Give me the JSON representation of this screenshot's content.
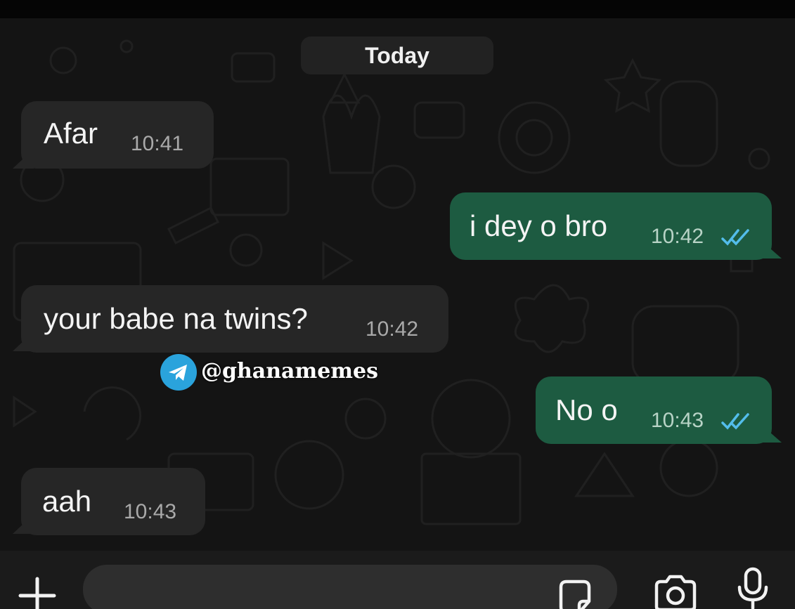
{
  "date_divider": "Today",
  "messages": [
    {
      "direction": "incoming",
      "text": "Afar",
      "time": "10:41"
    },
    {
      "direction": "outgoing",
      "text": "i dey o bro",
      "time": "10:42",
      "status": "read"
    },
    {
      "direction": "incoming",
      "text": "your babe na twins?",
      "time": "10:42"
    },
    {
      "direction": "outgoing",
      "text": "No o",
      "time": "10:43",
      "status": "read"
    },
    {
      "direction": "incoming",
      "text": "aah",
      "time": "10:43"
    }
  ],
  "watermark": {
    "icon": "telegram-icon",
    "handle": "@ghanamemes"
  },
  "input_bar": {
    "left_icon": "plus-icon",
    "input_placeholder": "",
    "icons": [
      "sticker-icon",
      "camera-icon",
      "microphone-icon"
    ]
  },
  "colors": {
    "background": "#141414",
    "incoming_bubble": "#262626",
    "outgoing_bubble": "#1d5b41",
    "read_ticks": "#53bdeb"
  }
}
